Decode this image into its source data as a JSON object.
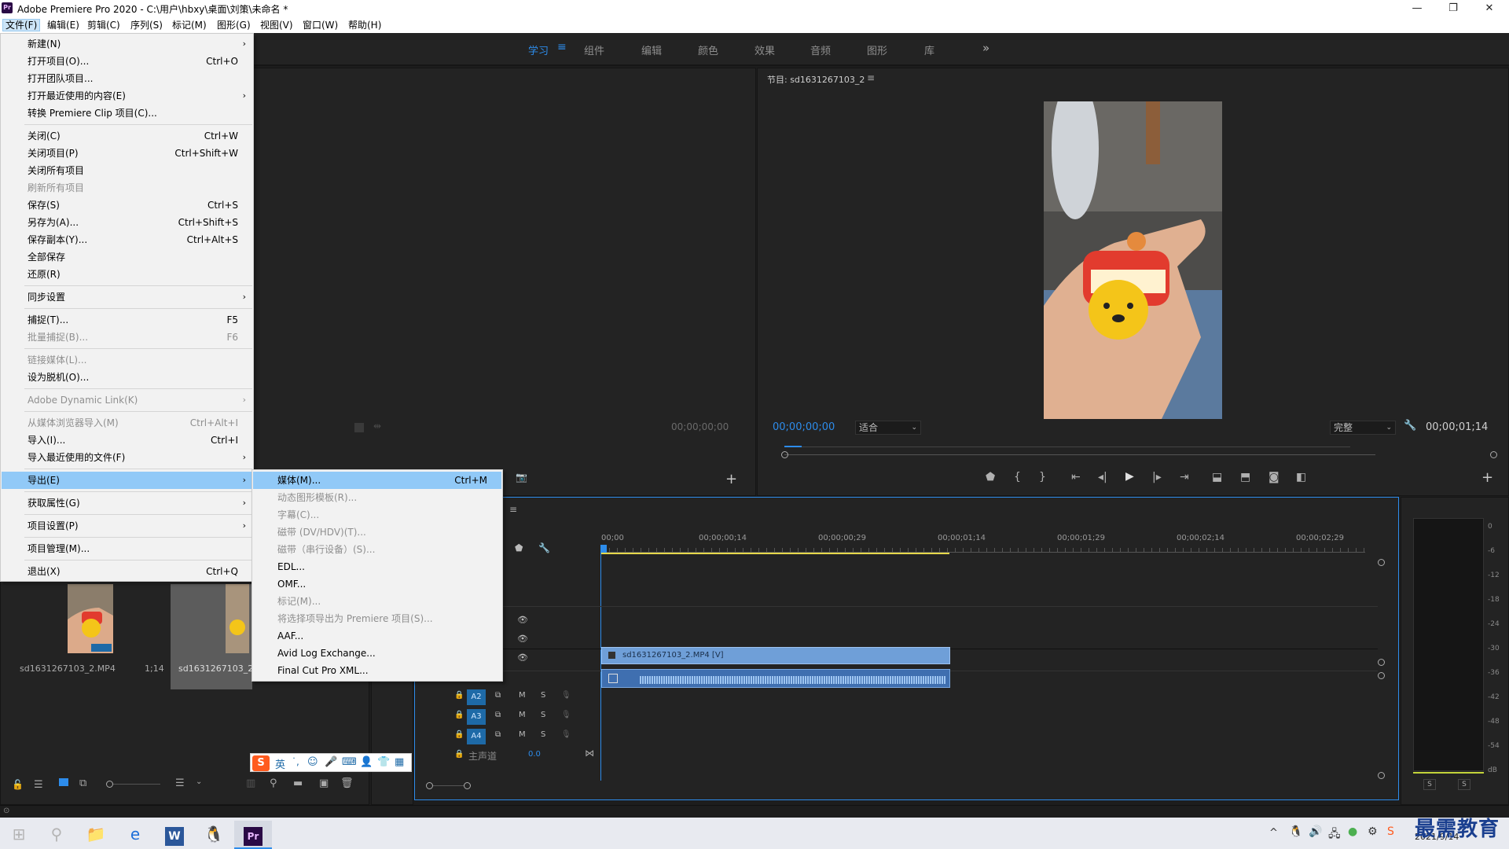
{
  "titlebar": {
    "app_icon": "Pr",
    "title": "Adobe Premiere Pro 2020 - C:\\用户\\hbxy\\桌面\\刘策\\未命名 *",
    "min": "—",
    "restore": "❐",
    "close": "✕"
  },
  "menubar": {
    "items": [
      "文件(F)",
      "编辑(E)",
      "剪辑(C)",
      "序列(S)",
      "标记(M)",
      "图形(G)",
      "视图(V)",
      "窗口(W)",
      "帮助(H)"
    ]
  },
  "workspace": {
    "tabs": [
      "学习",
      "组件",
      "编辑",
      "颜色",
      "效果",
      "音频",
      "图形",
      "库"
    ],
    "active_tab": "学习",
    "more": "»",
    "menu_icon": "≡"
  },
  "file_menu": {
    "items": [
      {
        "label": "新建(N)",
        "shortcut": "",
        "submenu": true,
        "disabled": false
      },
      {
        "label": "打开项目(O)...",
        "shortcut": "Ctrl+O",
        "submenu": false,
        "disabled": false
      },
      {
        "label": "打开团队项目...",
        "shortcut": "",
        "submenu": false,
        "disabled": false
      },
      {
        "label": "打开最近使用的内容(E)",
        "shortcut": "",
        "submenu": true,
        "disabled": false
      },
      {
        "label": "转换 Premiere Clip 项目(C)...",
        "shortcut": "",
        "submenu": false,
        "disabled": false
      },
      {
        "label": "关闭(C)",
        "shortcut": "Ctrl+W",
        "submenu": false,
        "disabled": false
      },
      {
        "label": "关闭项目(P)",
        "shortcut": "Ctrl+Shift+W",
        "submenu": false,
        "disabled": false
      },
      {
        "label": "关闭所有项目",
        "shortcut": "",
        "submenu": false,
        "disabled": false
      },
      {
        "label": "刷新所有项目",
        "shortcut": "",
        "submenu": false,
        "disabled": true
      },
      {
        "label": "保存(S)",
        "shortcut": "Ctrl+S",
        "submenu": false,
        "disabled": false
      },
      {
        "label": "另存为(A)...",
        "shortcut": "Ctrl+Shift+S",
        "submenu": false,
        "disabled": false
      },
      {
        "label": "保存副本(Y)...",
        "shortcut": "Ctrl+Alt+S",
        "submenu": false,
        "disabled": false
      },
      {
        "label": "全部保存",
        "shortcut": "",
        "submenu": false,
        "disabled": false
      },
      {
        "label": "还原(R)",
        "shortcut": "",
        "submenu": false,
        "disabled": false
      },
      {
        "label": "同步设置",
        "shortcut": "",
        "submenu": true,
        "disabled": false
      },
      {
        "label": "捕捉(T)...",
        "shortcut": "F5",
        "submenu": false,
        "disabled": false
      },
      {
        "label": "批量捕捉(B)...",
        "shortcut": "F6",
        "submenu": false,
        "disabled": true
      },
      {
        "label": "链接媒体(L)...",
        "shortcut": "",
        "submenu": false,
        "disabled": true
      },
      {
        "label": "设为脱机(O)...",
        "shortcut": "",
        "submenu": false,
        "disabled": false
      },
      {
        "label": "Adobe Dynamic Link(K)",
        "shortcut": "",
        "submenu": true,
        "disabled": true
      },
      {
        "label": "从媒体浏览器导入(M)",
        "shortcut": "Ctrl+Alt+I",
        "submenu": false,
        "disabled": true
      },
      {
        "label": "导入(I)...",
        "shortcut": "Ctrl+I",
        "submenu": false,
        "disabled": false
      },
      {
        "label": "导入最近使用的文件(F)",
        "shortcut": "",
        "submenu": true,
        "disabled": false
      },
      {
        "label": "导出(E)",
        "shortcut": "",
        "submenu": true,
        "disabled": false,
        "highlight": true
      },
      {
        "label": "获取属性(G)",
        "shortcut": "",
        "submenu": true,
        "disabled": false
      },
      {
        "label": "项目设置(P)",
        "shortcut": "",
        "submenu": true,
        "disabled": false
      },
      {
        "label": "项目管理(M)...",
        "shortcut": "",
        "submenu": false,
        "disabled": false
      },
      {
        "label": "退出(X)",
        "shortcut": "Ctrl+Q",
        "submenu": false,
        "disabled": false
      }
    ]
  },
  "export_menu": {
    "items": [
      {
        "label": "媒体(M)...",
        "shortcut": "Ctrl+M",
        "disabled": false,
        "highlight": true
      },
      {
        "label": "动态图形模板(R)...",
        "shortcut": "",
        "disabled": true
      },
      {
        "label": "字幕(C)...",
        "shortcut": "",
        "disabled": true
      },
      {
        "label": "磁带 (DV/HDV)(T)...",
        "shortcut": "",
        "disabled": true
      },
      {
        "label": "磁带（串行设备）(S)...",
        "shortcut": "",
        "disabled": true
      },
      {
        "label": "EDL...",
        "shortcut": "",
        "disabled": false
      },
      {
        "label": "OMF...",
        "shortcut": "",
        "disabled": false
      },
      {
        "label": "标记(M)...",
        "shortcut": "",
        "disabled": true
      },
      {
        "label": "将选择项导出为 Premiere 项目(S)...",
        "shortcut": "",
        "disabled": true
      },
      {
        "label": "AAF...",
        "shortcut": "",
        "disabled": false
      },
      {
        "label": "Avid Log Exchange...",
        "shortcut": "",
        "disabled": false
      },
      {
        "label": "Final Cut Pro XML...",
        "shortcut": "",
        "disabled": false
      }
    ]
  },
  "source_monitor": {
    "timecode": "00;00;00;00"
  },
  "program_monitor": {
    "title": "节目: sd1631267103_2",
    "menu_icon": "≡",
    "timecode": "00;00;00;00",
    "fit": "适合",
    "quality": "完整",
    "duration": "00;00;01;14"
  },
  "project": {
    "items": [
      {
        "name": "sd1631267103_2.MP4",
        "duration": "1;14"
      },
      {
        "name": "sd1631267103_2",
        "duration": ""
      }
    ]
  },
  "timeline": {
    "ruler": [
      "00;00",
      "00;00;00;14",
      "00;00;00;29",
      "00;00;01;14",
      "00;00;01;29",
      "00;00;02;14",
      "00;00;02;29"
    ],
    "video_clip": "sd1631267103_2.MP4 [V]",
    "audio_tracks": [
      "A2",
      "A3",
      "A4"
    ],
    "master_label": "主声道",
    "master_value": "0.0",
    "track_buttons": {
      "m": "M",
      "s": "S"
    }
  },
  "audio_meter": {
    "scale": [
      "0",
      "-6",
      "-12",
      "-18",
      "-24",
      "-30",
      "-36",
      "-42",
      "-48",
      "-54",
      "dB"
    ],
    "solo": [
      "S",
      "S"
    ]
  },
  "ime_toolbar": {
    "lang": "英",
    "punct": "˙,"
  },
  "taskbar": {
    "date": "2021/9/14",
    "watermark": "最需教育"
  },
  "colors": {
    "accent": "#2d8ceb",
    "menu_highlight": "#91c9f7",
    "panel_bg": "#232323",
    "clip_blue": "#6f9fd8"
  }
}
